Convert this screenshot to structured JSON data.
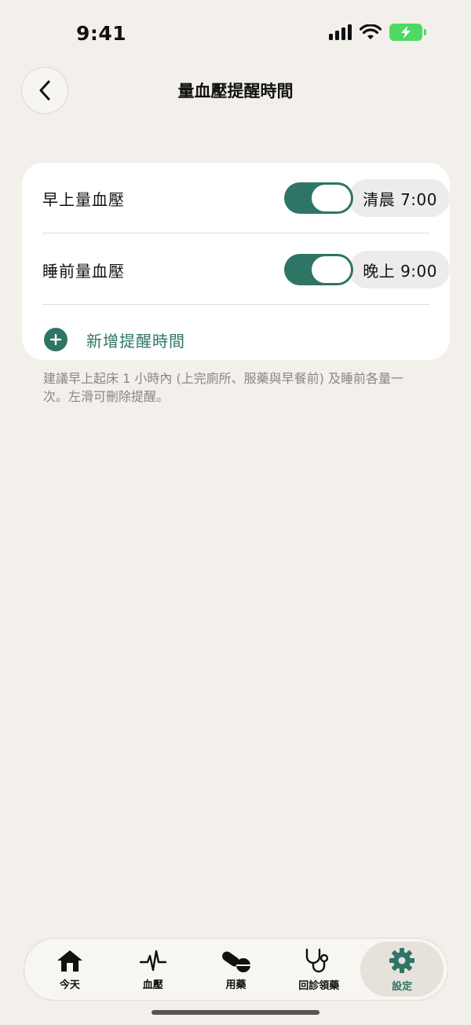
{
  "status_bar": {
    "time": "9:41"
  },
  "header": {
    "title": "量血壓提醒時間"
  },
  "reminders": [
    {
      "label": "早上量血壓",
      "enabled": true,
      "time": "清晨 7:00"
    },
    {
      "label": "睡前量血壓",
      "enabled": true,
      "time": "晚上 9:00"
    }
  ],
  "add_reminder": {
    "label": "新增提醒時間"
  },
  "hint": "建議早上起床 1 小時內 (上完廁所、服藥與早餐前) 及睡前各量一次。左滑可刪除提醒。",
  "tabbar": {
    "items": [
      {
        "label": "今天",
        "icon": "home-icon"
      },
      {
        "label": "血壓",
        "icon": "pulse-icon"
      },
      {
        "label": "用藥",
        "icon": "pill-icon"
      },
      {
        "label": "回診領藥",
        "icon": "stethoscope-icon"
      },
      {
        "label": "設定",
        "icon": "gear-icon",
        "active": true
      }
    ]
  },
  "colors": {
    "accent": "#2f7566",
    "background": "#f3f0eb",
    "card": "#ffffff"
  }
}
